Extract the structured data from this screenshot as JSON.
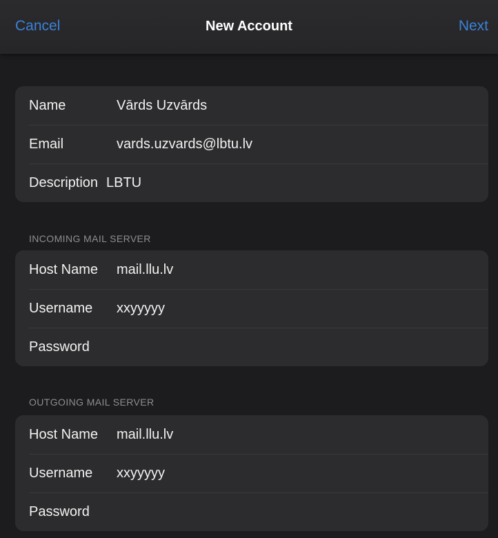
{
  "nav": {
    "cancel_label": "Cancel",
    "title": "New Account",
    "next_label": "Next",
    "accent_color": "#3b82d8"
  },
  "account": {
    "rows": [
      {
        "label": "Name",
        "value": "Vārds Uzvārds"
      },
      {
        "label": "Email",
        "value": "vards.uzvards@lbtu.lv"
      },
      {
        "label": "Description",
        "value": "LBTU"
      }
    ]
  },
  "incoming": {
    "header": "INCOMING MAIL SERVER",
    "rows": [
      {
        "label": "Host Name",
        "value": "mail.llu.lv"
      },
      {
        "label": "Username",
        "value": "xxyyyyy"
      },
      {
        "label": "Password",
        "value": ""
      }
    ]
  },
  "outgoing": {
    "header": "OUTGOING MAIL SERVER",
    "rows": [
      {
        "label": "Host Name",
        "value": "mail.llu.lv"
      },
      {
        "label": "Username",
        "value": "xxyyyyy"
      },
      {
        "label": "Password",
        "value": ""
      }
    ]
  }
}
